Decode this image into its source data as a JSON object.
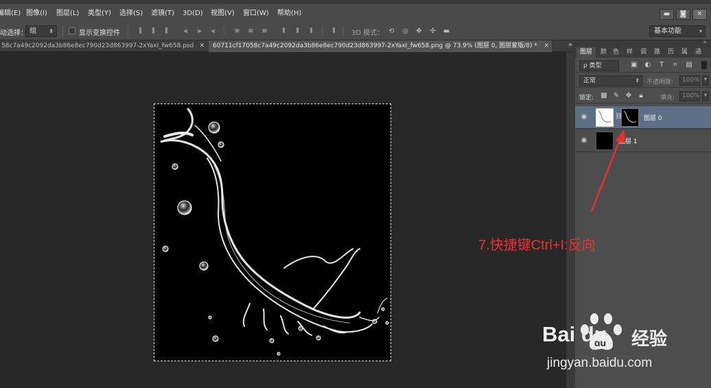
{
  "menubar": {
    "items": [
      "编辑(E)",
      "图像(I)",
      "图层(L)",
      "类型(Y)",
      "选择(S)",
      "滤镜(T)",
      "3D(D)",
      "视图(V)",
      "窗口(W)",
      "帮助(H)"
    ],
    "win_buttons": [
      "▬",
      "◙",
      "✕"
    ]
  },
  "options": {
    "auto_select_label": "动选择：",
    "auto_select_value": "组",
    "show_transform_label": "显示变换控件",
    "mode_3d_label": "3D 模式：",
    "workspace": "基本功能"
  },
  "tabs": [
    {
      "label": "58c7a49c2092da3b86e8ec790d23d863997-2xYaxI_fw658.psd",
      "close": "✕"
    },
    {
      "label": "60711cf17058c7a49c2092da3b86e8ec790d23d863997-2xYaxI_fw658.png @ 73.9% (图层 0, 图层蒙版/8) *",
      "close": "✕"
    }
  ],
  "tab_overflow": "»",
  "panel": {
    "tabs": [
      "图层",
      "颜",
      "色",
      "样",
      "调",
      "路",
      "历",
      "属",
      "通"
    ],
    "filter_kind": "ρ 类型",
    "blend_mode": "正常",
    "opacity_label": "不透明度:",
    "opacity_value": "100%",
    "lock_label": "锁定:",
    "fill_label": "填充:",
    "fill_value": "100%",
    "layers": [
      {
        "name": "图层 0",
        "selected": true,
        "has_mask": true
      },
      {
        "name": "图层 1",
        "selected": false,
        "has_mask": false
      }
    ]
  },
  "annotation": {
    "text": "7.快捷键Ctrl+I:反向",
    "color": "#e8312f"
  },
  "watermark": {
    "brand": "Bai du",
    "cn": "经验",
    "url": "jingyan.baidu.com"
  },
  "icons": [
    "eye-icon",
    "chain-icon",
    "paw-icon",
    "close-icon",
    "lock-icon",
    "search-icon"
  ]
}
